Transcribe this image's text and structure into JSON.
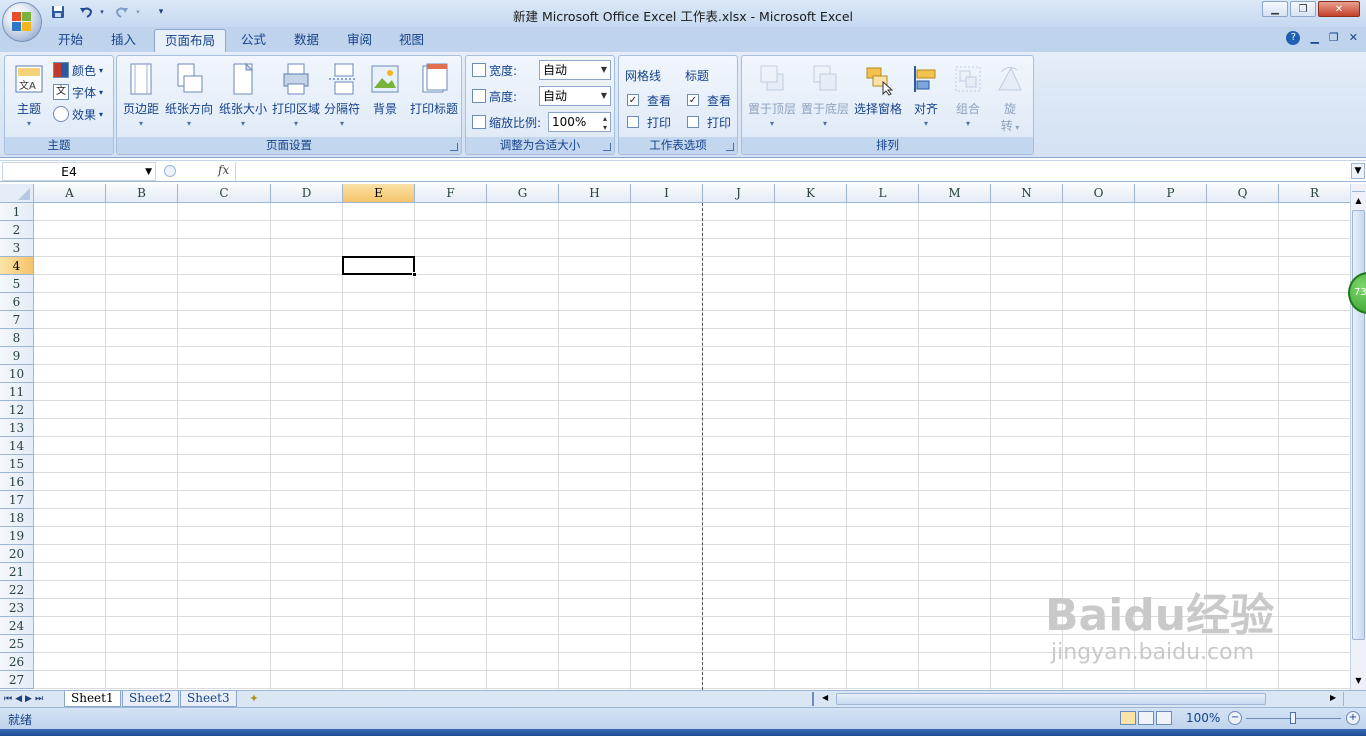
{
  "window": {
    "title": "新建 Microsoft Office Excel 工作表.xlsx - Microsoft Excel",
    "controls": [
      "minimize",
      "restore",
      "close"
    ]
  },
  "qat": {
    "icons": [
      "save-icon",
      "undo-icon",
      "redo-icon",
      "customize-icon"
    ]
  },
  "tabs": [
    {
      "label": "开始"
    },
    {
      "label": "插入"
    },
    {
      "label": "页面布局",
      "active": true
    },
    {
      "label": "公式"
    },
    {
      "label": "数据"
    },
    {
      "label": "审阅"
    },
    {
      "label": "视图"
    }
  ],
  "ribbon": {
    "theme_group": {
      "label": "主题",
      "theme_button": "主题",
      "colors": "颜色",
      "fonts": "字体",
      "effects": "效果"
    },
    "page_setup_group": {
      "label": "页面设置",
      "buttons": [
        "页边距",
        "纸张方向",
        "纸张大小",
        "打印区域",
        "分隔符",
        "背景",
        "打印标题"
      ]
    },
    "scale_group": {
      "label": "调整为合适大小",
      "width_label": "宽度:",
      "width_value": "自动",
      "height_label": "高度:",
      "height_value": "自动",
      "scale_label": "缩放比例:",
      "scale_value": "100%"
    },
    "sheet_options_group": {
      "label": "工作表选项",
      "gridlines_label": "网格线",
      "headings_label": "标题",
      "view_label": "查看",
      "print_label": "打印",
      "gridlines_view_checked": true,
      "gridlines_print_checked": false,
      "headings_view_checked": true,
      "headings_print_checked": false
    },
    "arrange_group": {
      "label": "排列",
      "bring_front": "置于顶层",
      "send_back": "置于底层",
      "selection_pane": "选择窗格",
      "align": "对齐",
      "group": "组合",
      "rotate_1": "旋",
      "rotate_2": "转"
    }
  },
  "formula_bar": {
    "name_box": "E4",
    "fx": "fx",
    "content": ""
  },
  "sheet": {
    "columns": [
      "A",
      "B",
      "C",
      "D",
      "E",
      "F",
      "G",
      "H",
      "I",
      "J",
      "K",
      "L",
      "M",
      "N",
      "O",
      "P",
      "Q",
      "R"
    ],
    "rows": [
      "1",
      "2",
      "3",
      "4",
      "5",
      "6",
      "7",
      "8",
      "9",
      "10",
      "11",
      "12",
      "13",
      "14",
      "15",
      "16",
      "17",
      "18",
      "19",
      "20",
      "21",
      "22",
      "23",
      "24",
      "25",
      "26",
      "27"
    ],
    "active_cell": "E4"
  },
  "sheet_tabs": [
    {
      "label": "Sheet1",
      "active": true
    },
    {
      "label": "Sheet2"
    },
    {
      "label": "Sheet3"
    }
  ],
  "status": {
    "ready": "就绪",
    "zoom": "100%"
  },
  "side_badge": "73",
  "watermark": {
    "brand": "Baidu经验",
    "url": "jingyan.baidu.com"
  },
  "colors": {
    "ribbon_bg": "#dbe7f6",
    "selected_header": "#f4c46a",
    "gridline": "#dadcdd"
  }
}
